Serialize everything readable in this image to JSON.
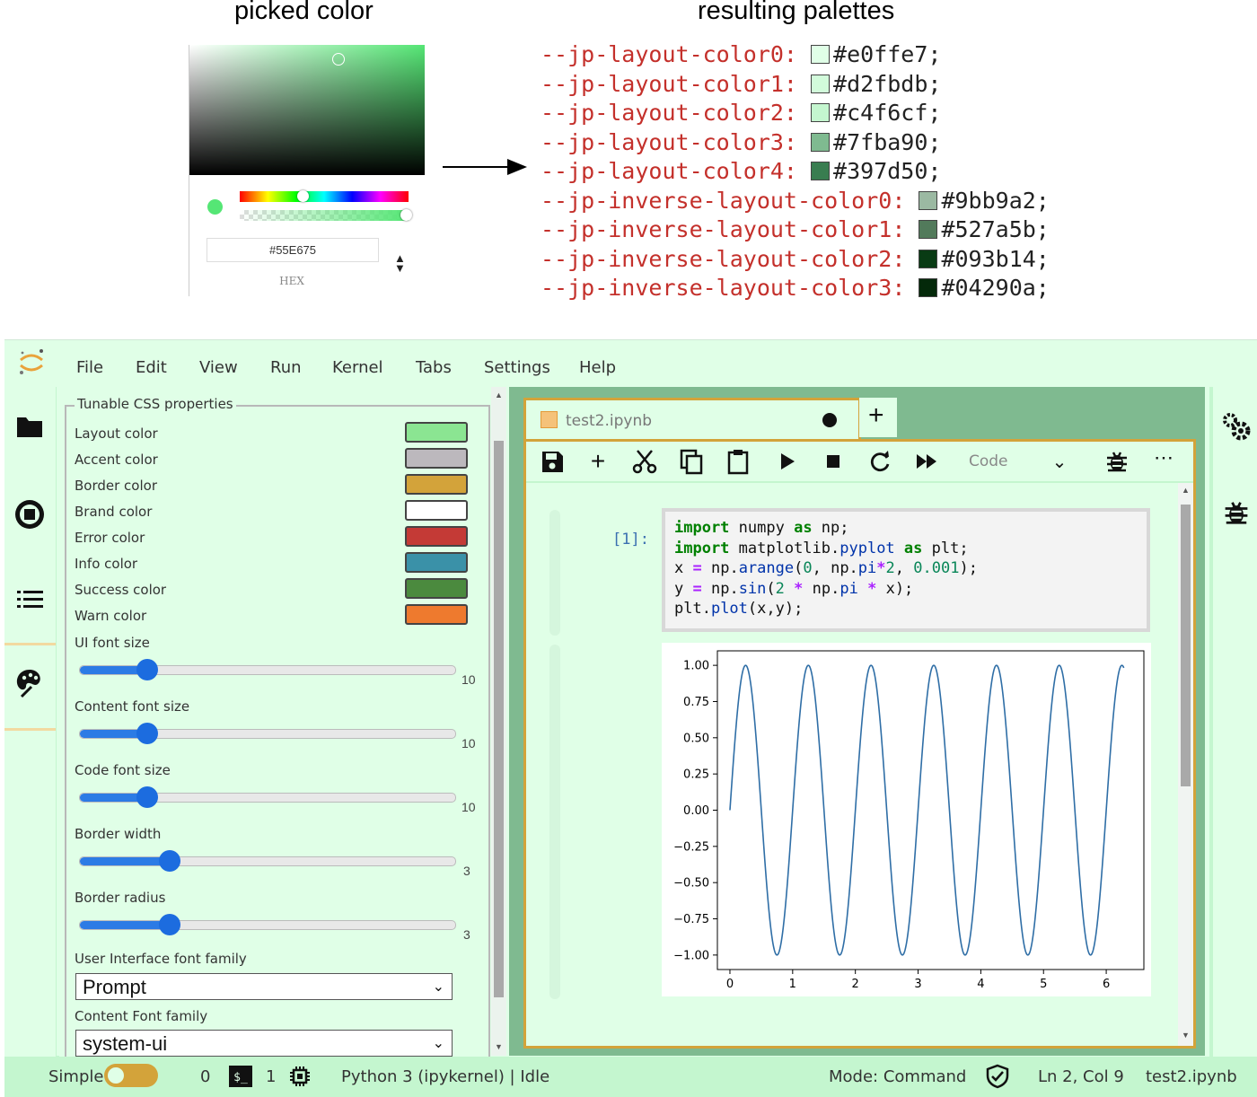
{
  "illustration": {
    "picked_title": "picked color",
    "palettes_title": "resulting palettes",
    "picker": {
      "hex_value": "#55E675",
      "hex_label": "HEX",
      "color": "#55e675"
    },
    "palettes": [
      {
        "name": "--jp-layout-color0:",
        "value": "#e0ffe7;",
        "color": "#e0ffe7"
      },
      {
        "name": "--jp-layout-color1:",
        "value": "#d2fbdb;",
        "color": "#d2fbdb"
      },
      {
        "name": "--jp-layout-color2:",
        "value": "#c4f6cf;",
        "color": "#c4f6cf"
      },
      {
        "name": "--jp-layout-color3:",
        "value": "#7fba90;",
        "color": "#7fba90"
      },
      {
        "name": "--jp-layout-color4:",
        "value": "#397d50;",
        "color": "#397d50"
      },
      {
        "name": "--jp-inverse-layout-color0:",
        "value": "#9bb9a2;",
        "color": "#9bb9a2"
      },
      {
        "name": "--jp-inverse-layout-color1:",
        "value": "#527a5b;",
        "color": "#527a5b"
      },
      {
        "name": "--jp-inverse-layout-color2:",
        "value": "#093b14;",
        "color": "#093b14"
      },
      {
        "name": "--jp-inverse-layout-color3:",
        "value": "#04290a;",
        "color": "#04290a"
      }
    ]
  },
  "menu": [
    "File",
    "Edit",
    "View",
    "Run",
    "Kernel",
    "Tabs",
    "Settings",
    "Help"
  ],
  "properties_panel": {
    "legend": "Tunable CSS properties",
    "colors": [
      {
        "label": "Layout color",
        "color": "#8be592"
      },
      {
        "label": "Accent color",
        "color": "#bcb8bd"
      },
      {
        "label": "Border color",
        "color": "#d3a33a"
      },
      {
        "label": "Brand color",
        "color": "#ffffff"
      },
      {
        "label": "Error color",
        "color": "#c43a36"
      },
      {
        "label": "Info color",
        "color": "#3a91a8"
      },
      {
        "label": "Success color",
        "color": "#4b8a3e"
      },
      {
        "label": "Warn color",
        "color": "#ee7a2e"
      }
    ],
    "sliders": [
      {
        "label": "UI font size",
        "value": "10",
        "fraction": 0.18
      },
      {
        "label": "Content font size",
        "value": "10",
        "fraction": 0.18
      },
      {
        "label": "Code font size",
        "value": "10",
        "fraction": 0.18
      },
      {
        "label": "Border width",
        "value": "3",
        "fraction": 0.24
      },
      {
        "label": "Border radius",
        "value": "3",
        "fraction": 0.24
      }
    ],
    "ui_font_label": "User Interface font family",
    "ui_font_value": "Prompt",
    "content_font_label": "Content Font family",
    "content_font_value": "system-ui"
  },
  "notebook": {
    "tab_name": "test2.ipynb",
    "cell_type": "Code",
    "prompt": "[1]:",
    "code": [
      [
        [
          "kw",
          "import"
        ],
        [
          "t",
          " numpy "
        ],
        [
          "kw",
          "as"
        ],
        [
          "t",
          " np;"
        ]
      ],
      [
        [
          "kw",
          "import"
        ],
        [
          "t",
          " matplotlib."
        ],
        [
          "fn",
          "pyplot"
        ],
        [
          "t",
          " "
        ],
        [
          "kw",
          "as"
        ],
        [
          "t",
          " plt;"
        ]
      ],
      [
        [
          "t",
          "x "
        ],
        [
          "op",
          "="
        ],
        [
          "t",
          " np."
        ],
        [
          "fn",
          "arange"
        ],
        [
          "t",
          "("
        ],
        [
          "num",
          "0"
        ],
        [
          "t",
          ", np."
        ],
        [
          "fn",
          "pi"
        ],
        [
          "op",
          "*"
        ],
        [
          "num",
          "2"
        ],
        [
          "t",
          ", "
        ],
        [
          "num",
          "0.001"
        ],
        [
          "t",
          ");"
        ]
      ],
      [
        [
          "t",
          "y "
        ],
        [
          "op",
          "="
        ],
        [
          "t",
          " np."
        ],
        [
          "fn",
          "sin"
        ],
        [
          "t",
          "("
        ],
        [
          "num",
          "2"
        ],
        [
          "t",
          " "
        ],
        [
          "op",
          "*"
        ],
        [
          "t",
          " np."
        ],
        [
          "fn",
          "pi"
        ],
        [
          "t",
          " "
        ],
        [
          "op",
          "*"
        ],
        [
          "t",
          " x);"
        ]
      ],
      [
        [
          "t",
          "plt."
        ],
        [
          "fn",
          "plot"
        ],
        [
          "t",
          "(x,y);"
        ]
      ]
    ]
  },
  "chart_data": {
    "type": "line",
    "x_ticks": [
      "0",
      "1",
      "2",
      "3",
      "4",
      "5",
      "6"
    ],
    "y_ticks": [
      "1.00",
      "0.75",
      "0.50",
      "0.25",
      "0.00",
      "−0.25",
      "−0.50",
      "−0.75",
      "−1.00"
    ],
    "xlim": [
      -0.2,
      6.6
    ],
    "ylim": [
      -1.1,
      1.1
    ],
    "series": [
      {
        "function": "y = sin(2*pi*x)",
        "x_range": [
          0,
          6.283
        ],
        "color": "#2f6ea6"
      }
    ]
  },
  "statusbar": {
    "mode_label": "Simple",
    "terminals": "0",
    "kernels": "1",
    "kernel_status": "Python 3 (ipykernel) | Idle",
    "mode": "Mode: Command",
    "position": "Ln 2, Col 9",
    "file": "test2.ipynb"
  }
}
